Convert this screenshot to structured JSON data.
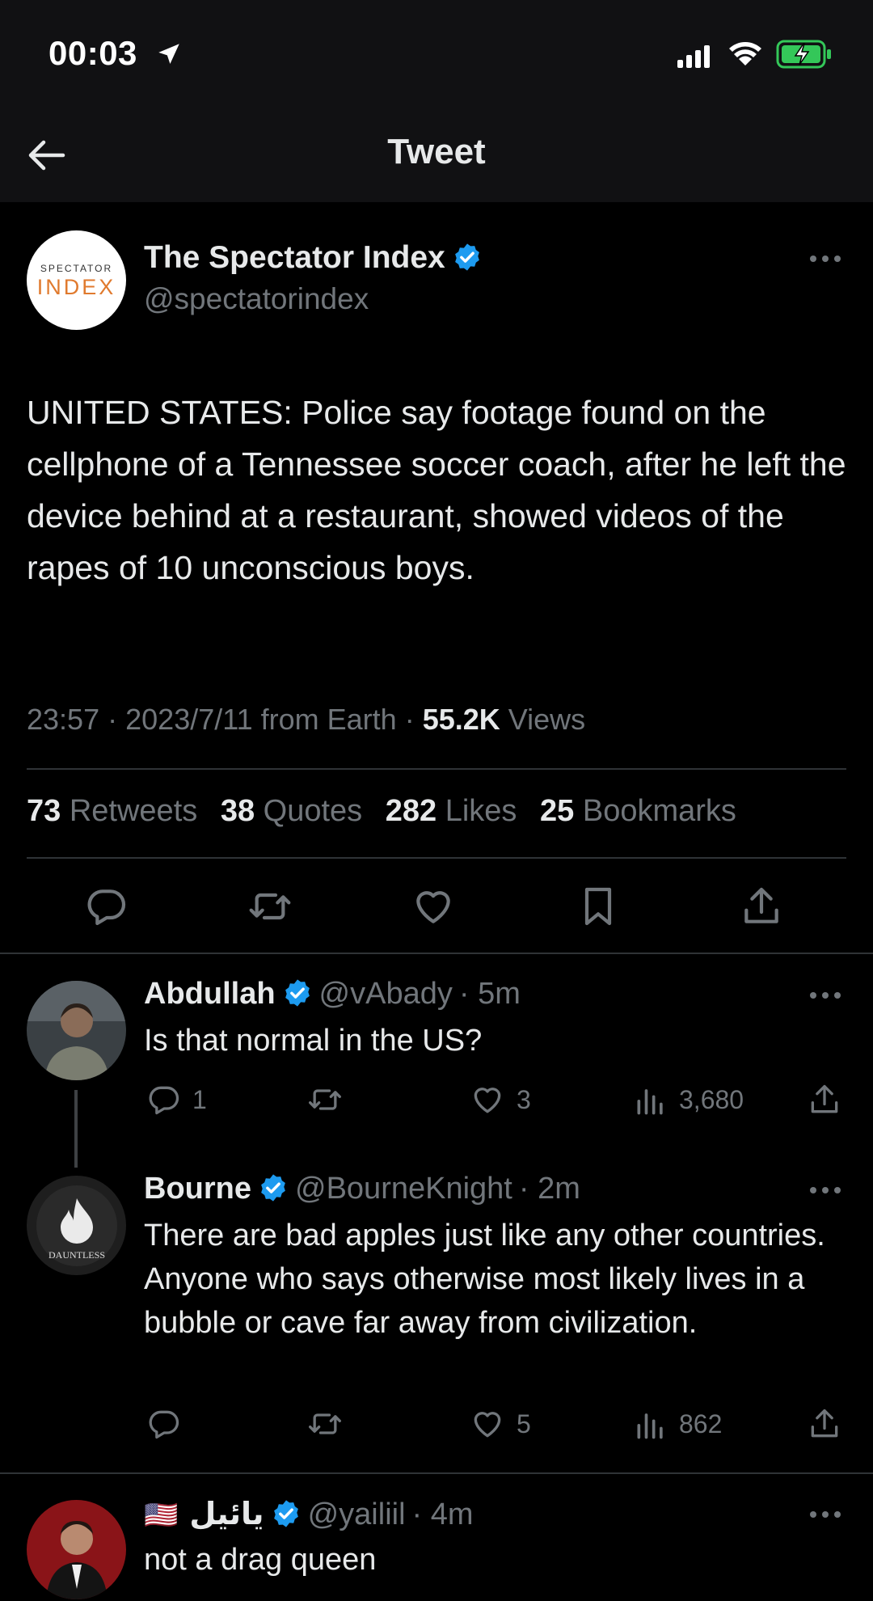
{
  "status_bar": {
    "time": "00:03"
  },
  "header": {
    "title": "Tweet"
  },
  "tweet": {
    "avatar": {
      "logo_top": "SPECTATOR",
      "logo_main": "INDEX"
    },
    "author_name": "The Spectator Index",
    "handle": "@spectatorindex",
    "text": "UNITED STATES: Police say footage found on the cellphone of a Tennessee soccer coach, after he left the device behind at a restaurant, showed videos of the rapes of 10 unconscious boys.",
    "meta": {
      "time": "23:57",
      "date": "2023/7/11",
      "source": "from Earth",
      "views_count": "55.2K",
      "views_label": "Views",
      "sep": "·"
    },
    "stats": [
      {
        "count": "73",
        "label": "Retweets"
      },
      {
        "count": "38",
        "label": "Quotes"
      },
      {
        "count": "282",
        "label": "Likes"
      },
      {
        "count": "25",
        "label": "Bookmarks"
      }
    ]
  },
  "replies": [
    {
      "name": "Abdullah",
      "handle": "@vAbady",
      "time": "· 5m",
      "text": "Is that normal in the US?",
      "replies": "1",
      "retweets": "",
      "likes": "3",
      "views": "3,680"
    },
    {
      "name": "Bourne",
      "handle": "@BourneKnight",
      "time": "· 2m",
      "text": "There are bad apples just like any other countries. Anyone who says otherwise most likely lives in a bubble or cave far away from civilization.",
      "avatar_text": "DAUNTLESS",
      "replies": "",
      "retweets": "",
      "likes": "5",
      "views": "862"
    },
    {
      "flag": "🇺🇸",
      "name": "يائيل",
      "handle": "@yailiil",
      "time": "· 4m",
      "text": "not a drag queen"
    }
  ],
  "colors": {
    "accent": "#1d9bf0",
    "muted": "#71767b",
    "text": "#e7e9ea",
    "battery": "#34c759"
  }
}
